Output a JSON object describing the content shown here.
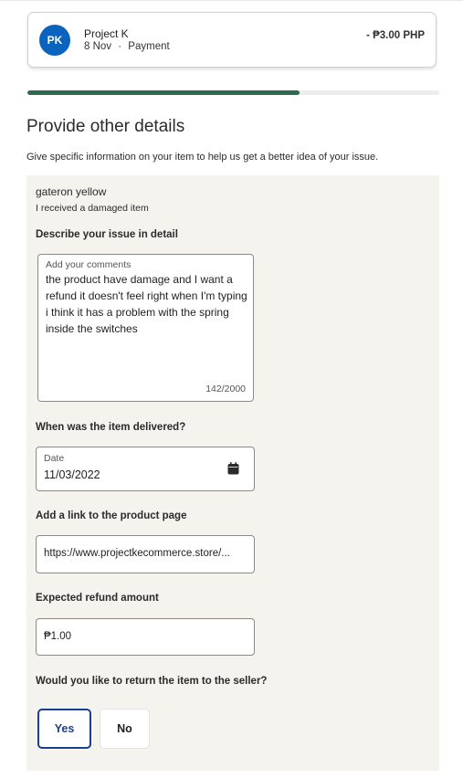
{
  "transaction": {
    "avatar_initials": "PK",
    "merchant": "Project K",
    "date": "8 Nov",
    "separator": "·",
    "type": "Payment",
    "amount": "- ₱3.00 PHP"
  },
  "progress": {
    "percent": 66
  },
  "form": {
    "heading": "Provide other details",
    "subtext": "Give specific information on your item to help us get a better idea of your issue.",
    "item_name": "gateron yellow",
    "item_reason": "I received a damaged item",
    "describe": {
      "label": "Describe your issue in detail",
      "field_label": "Add your comments",
      "value": "the product have damage and I want a refund it doesn't feel right when I'm typing i think it has a problem with the spring inside the switches",
      "count": "142/2000"
    },
    "delivered": {
      "label": "When was the item delivered?",
      "field_label": "Date",
      "value": "11/03/2022",
      "icon": "calendar-icon"
    },
    "product_link": {
      "label": "Add a link to the product page",
      "value": "https://www.projectkecommerce.store/..."
    },
    "refund": {
      "label": "Expected refund amount",
      "value": "₱1.00"
    },
    "return_item": {
      "label": "Would you like to return the item to the seller?",
      "yes_label": "Yes",
      "no_label": "No",
      "selected": "Yes"
    }
  },
  "colors": {
    "avatar": "#0a63bd",
    "progress": "#2e6a50",
    "selected_button": "#1b3f8f",
    "panel_bg": "#f4f3ee"
  }
}
